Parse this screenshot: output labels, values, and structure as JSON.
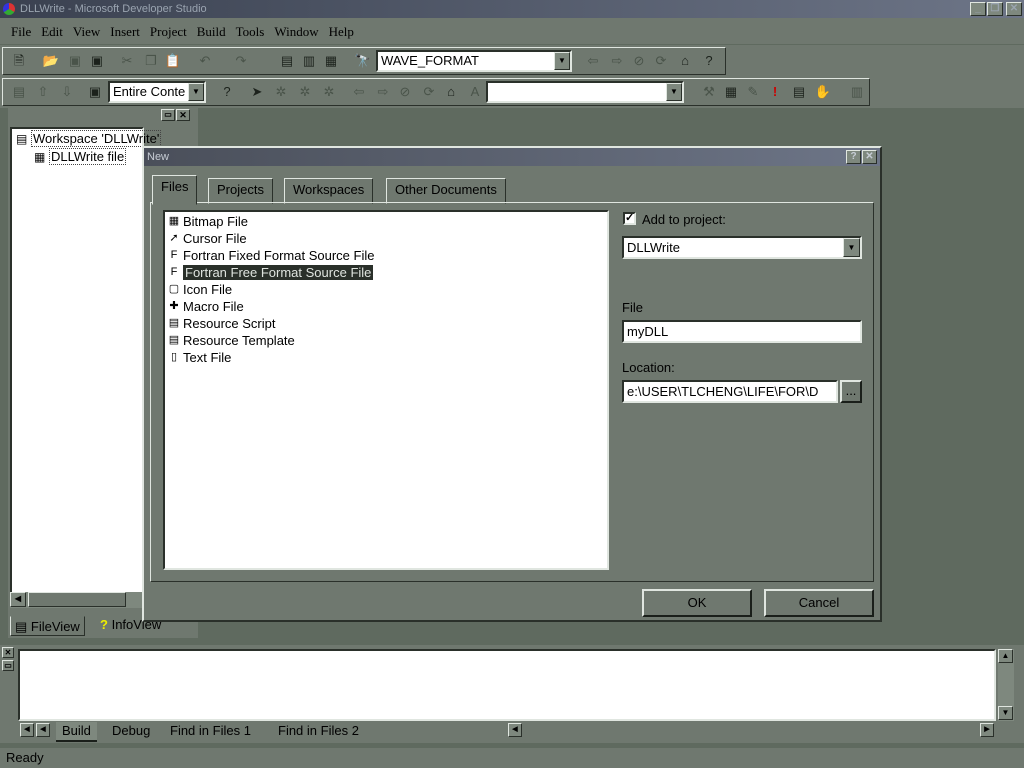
{
  "app": {
    "title": "DLLWrite - Microsoft Developer Studio"
  },
  "menubar": [
    "File",
    "Edit",
    "View",
    "Insert",
    "Project",
    "Build",
    "Tools",
    "Window",
    "Help"
  ],
  "toolbar1": {
    "combo_value": "WAVE_FORMAT"
  },
  "toolbar2": {
    "scope_combo": "Entire Conte",
    "find_combo": ""
  },
  "workspace": {
    "root": "Workspace 'DLLWrite'",
    "child": "DLLWrite file",
    "tabs": [
      "FileView",
      "InfoView"
    ]
  },
  "dialog": {
    "title": "New",
    "tabs": [
      "Files",
      "Projects",
      "Workspaces",
      "Other Documents"
    ],
    "file_types": [
      {
        "label": "Bitmap File",
        "icon": "bitmap-file-icon",
        "glyph": "▦"
      },
      {
        "label": "Cursor File",
        "icon": "cursor-file-icon",
        "glyph": "➚"
      },
      {
        "label": "Fortran Fixed Format Source File",
        "icon": "fortran-fixed-icon",
        "glyph": "F"
      },
      {
        "label": "Fortran Free Format Source File",
        "icon": "fortran-free-icon",
        "glyph": "F"
      },
      {
        "label": "Icon File",
        "icon": "icon-file-icon",
        "glyph": "▢"
      },
      {
        "label": "Macro File",
        "icon": "macro-file-icon",
        "glyph": "✚"
      },
      {
        "label": "Resource Script",
        "icon": "resource-script-icon",
        "glyph": "▤"
      },
      {
        "label": "Resource Template",
        "icon": "resource-template-icon",
        "glyph": "▤"
      },
      {
        "label": "Text File",
        "icon": "text-file-icon",
        "glyph": "▯"
      }
    ],
    "selected_index": 3,
    "add_to_project_label": "Add to project:",
    "add_to_project_checked": true,
    "project_value": "DLLWrite",
    "file_label": "File",
    "file_value": "myDLL",
    "location_label": "Location:",
    "location_value": "e:\\USER\\TLCHENG\\LIFE\\FOR\\D",
    "browse_label": "...",
    "ok_label": "OK",
    "cancel_label": "Cancel"
  },
  "output": {
    "tabs": [
      "Build",
      "Debug",
      "Find in Files 1",
      "Find in Files 2"
    ]
  },
  "status": {
    "text": "Ready"
  }
}
